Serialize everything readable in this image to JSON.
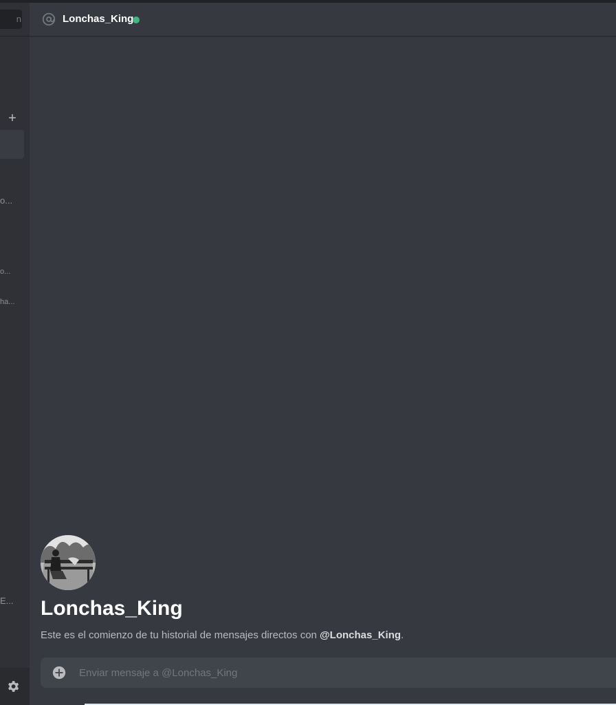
{
  "sidebar": {
    "search_text": "n",
    "add_dm_symbol": "+",
    "dm_snippets": [
      "o...",
      "o...",
      "ha...",
      "E..."
    ],
    "settings_icon": "gear-icon"
  },
  "chat": {
    "header": {
      "icon": "at-icon",
      "username": "Lonchas_King",
      "status_color": "#43b581"
    },
    "welcome": {
      "title": "Lonchas_King",
      "desc_prefix": "Este es el comienzo de tu historial de mensajes directos con ",
      "desc_mention": "@Lonchas_King",
      "desc_suffix": "."
    },
    "composer": {
      "attach_icon": "plus-circle-icon",
      "placeholder": "Enviar mensaje a @Lonchas_King",
      "value": ""
    }
  },
  "colors": {
    "background": "#36393f",
    "sidebar": "#2f3136",
    "online": "#43b581"
  }
}
